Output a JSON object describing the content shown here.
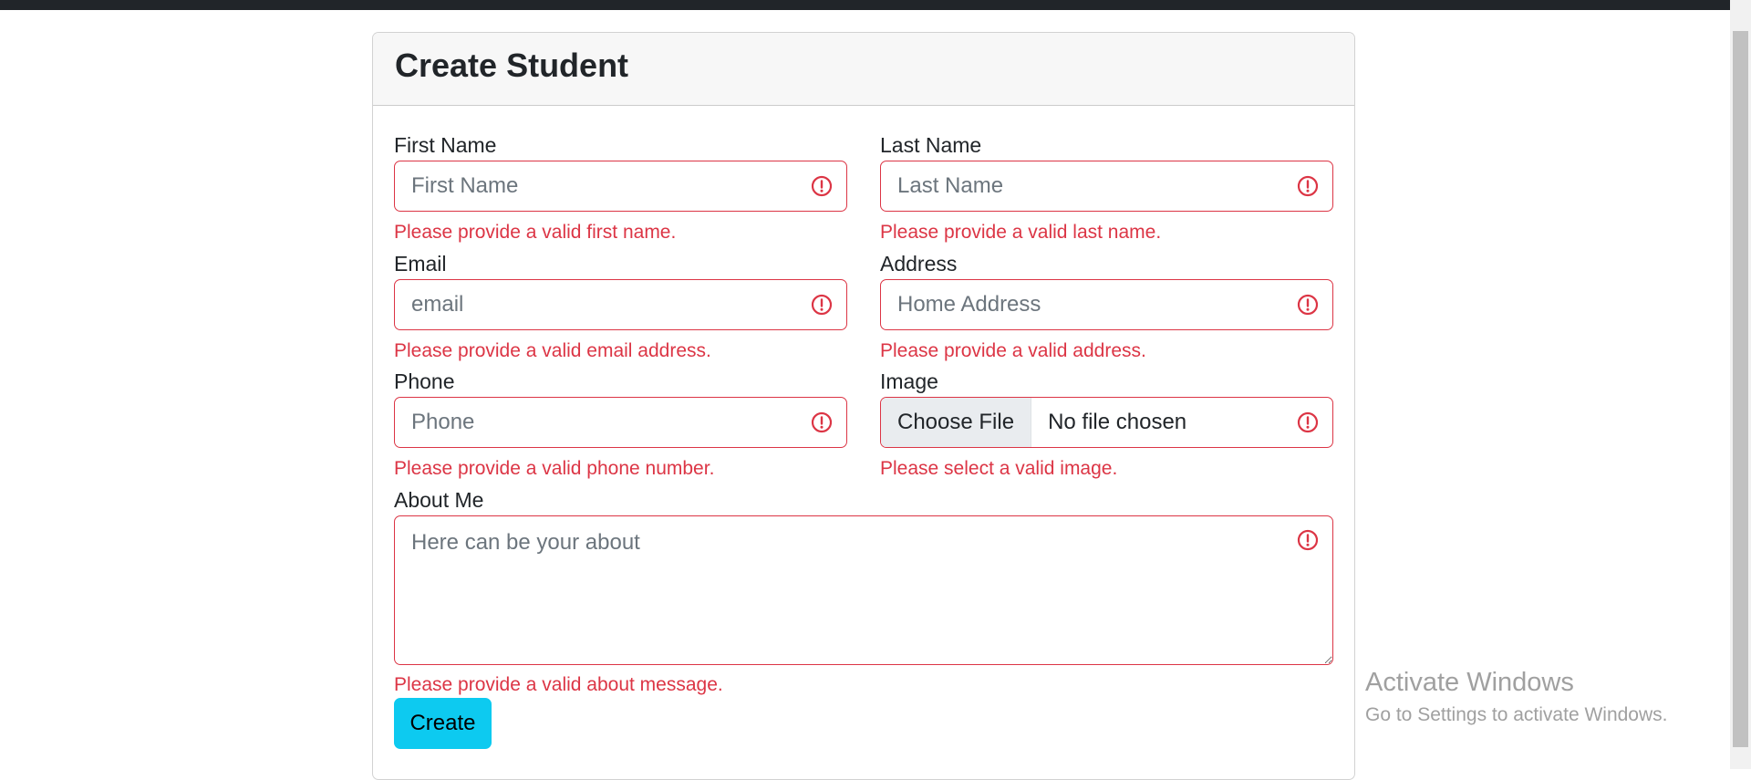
{
  "form": {
    "title": "Create Student",
    "fields": {
      "first_name": {
        "label": "First Name",
        "placeholder": "First Name",
        "feedback": "Please provide a valid first name."
      },
      "last_name": {
        "label": "Last Name",
        "placeholder": "Last Name",
        "feedback": "Please provide a valid last name."
      },
      "email": {
        "label": "Email",
        "placeholder": "email",
        "feedback": "Please provide a valid email address."
      },
      "address": {
        "label": "Address",
        "placeholder": "Home Address",
        "feedback": "Please provide a valid address."
      },
      "phone": {
        "label": "Phone",
        "placeholder": "Phone",
        "feedback": "Please provide a valid phone number."
      },
      "image": {
        "label": "Image",
        "button": "Choose File",
        "status": "No file chosen",
        "feedback": "Please select a valid image."
      },
      "about": {
        "label": "About Me",
        "placeholder": "Here can be your about",
        "feedback": "Please provide a valid about message."
      }
    },
    "submit_label": "Create",
    "error_color": "#dc3545",
    "accent_color": "#0dcaf0",
    "error_icon": "exclamation-circle-icon"
  },
  "watermark": {
    "title": "Activate Windows",
    "subtitle": "Go to Settings to activate Windows."
  }
}
